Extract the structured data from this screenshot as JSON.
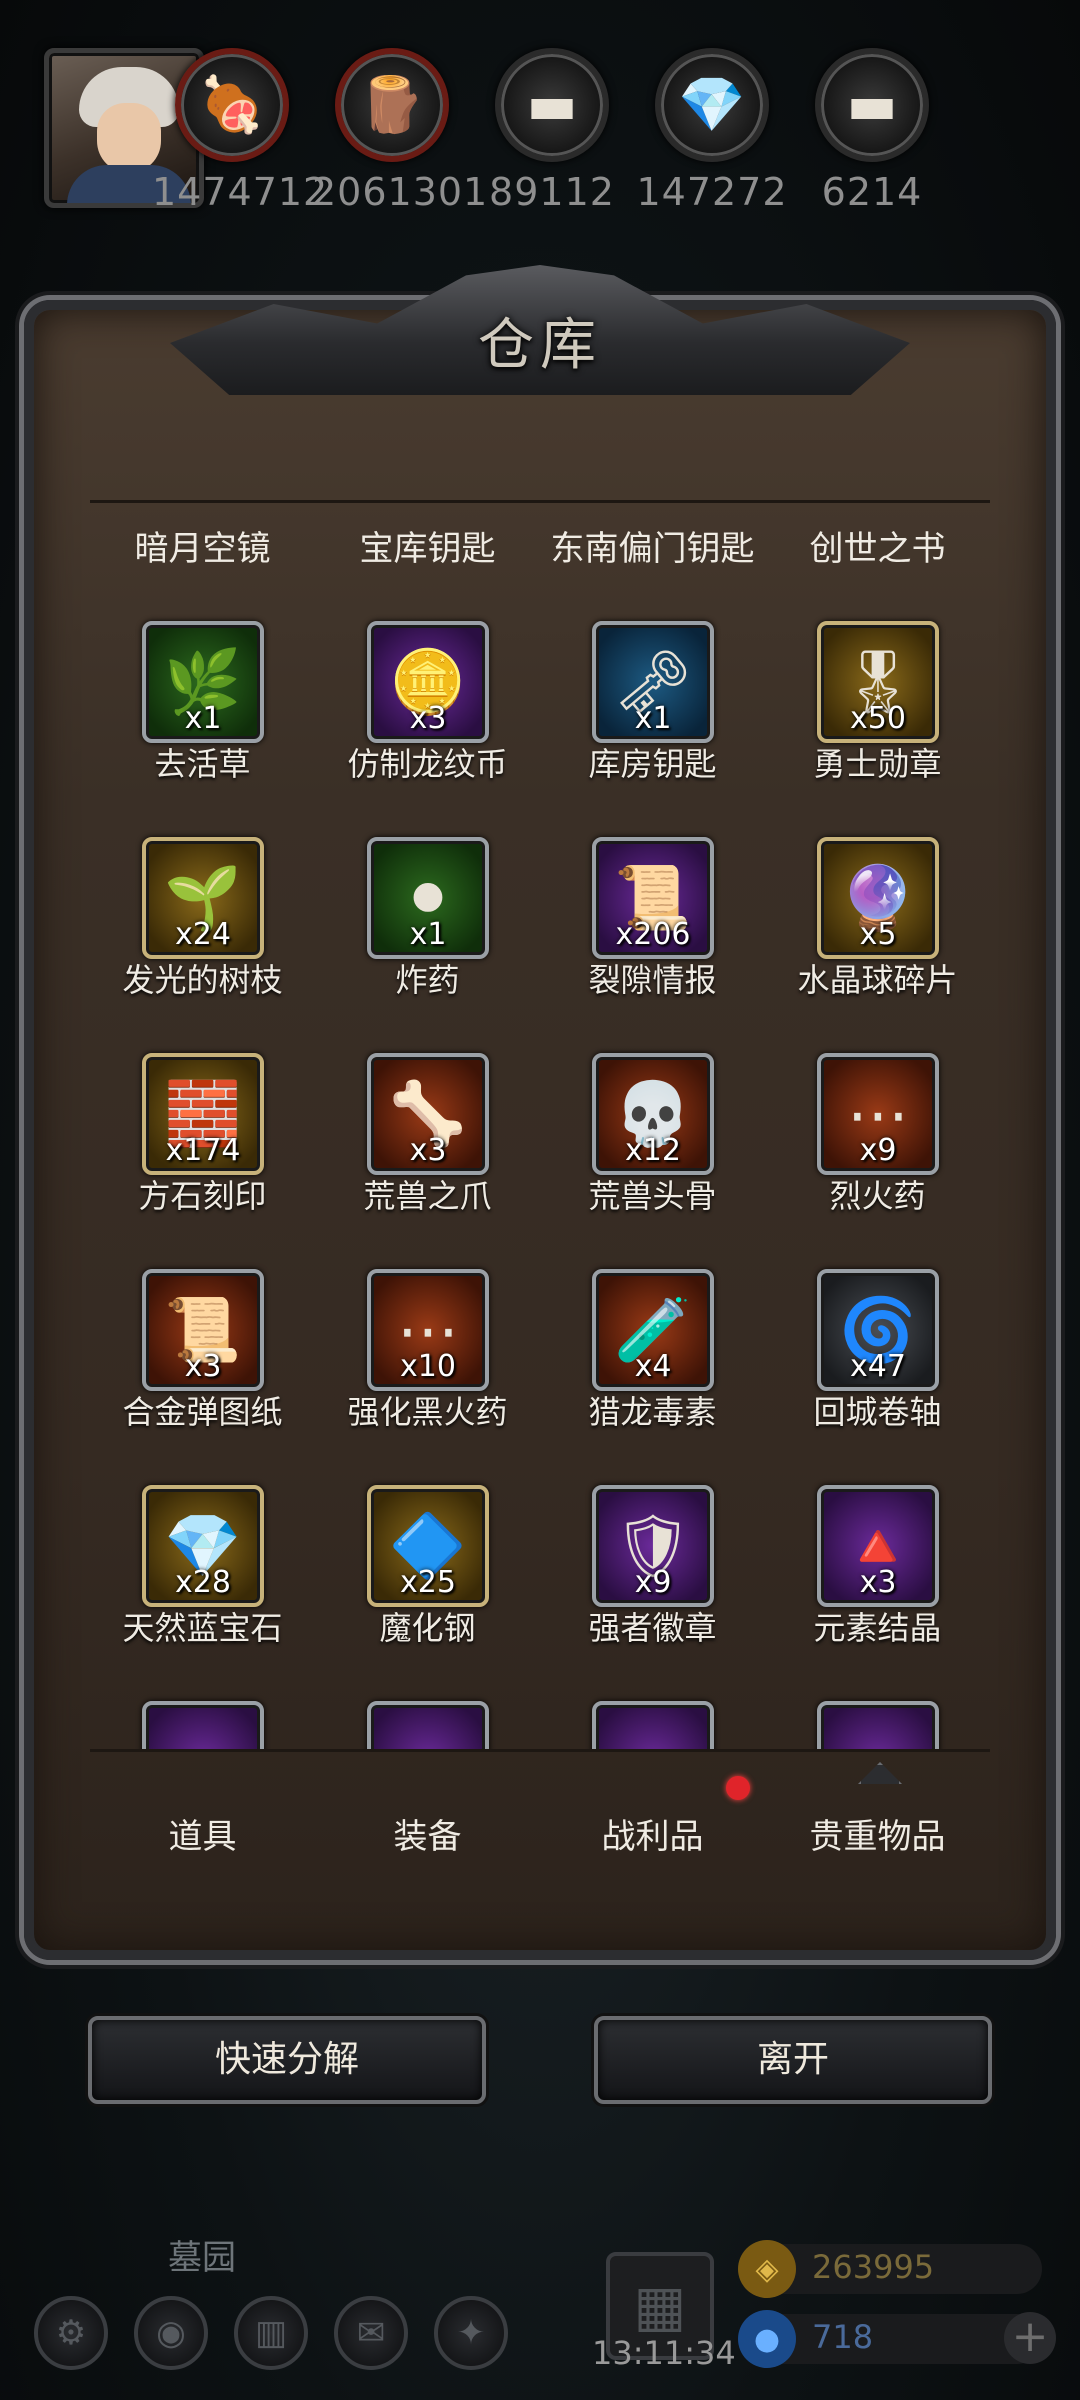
{
  "resources": [
    {
      "icon": "meat-icon",
      "glyph": "🍖",
      "value": "1474712",
      "accent": "red"
    },
    {
      "icon": "wood-icon",
      "glyph": "🪵",
      "value": "2061301",
      "accent": "red"
    },
    {
      "icon": "iron-icon",
      "glyph": "▬",
      "value": "89112",
      "accent": "none"
    },
    {
      "icon": "crystal-icon",
      "glyph": "💎",
      "value": "147272",
      "accent": "none"
    },
    {
      "icon": "steel-icon",
      "glyph": "▬",
      "value": "6214",
      "accent": "none"
    }
  ],
  "panel": {
    "title": "仓库"
  },
  "top_row": [
    "暗月空镜",
    "宝库钥匙",
    "东南偏门钥匙",
    "创世之书"
  ],
  "items": [
    {
      "name": "去活草",
      "count": "x1",
      "rarity": "green",
      "glyph": "🌿"
    },
    {
      "name": "仿制龙纹币",
      "count": "x3",
      "rarity": "purple",
      "glyph": "🪙"
    },
    {
      "name": "库房钥匙",
      "count": "x1",
      "rarity": "blue",
      "glyph": "🗝"
    },
    {
      "name": "勇士勋章",
      "count": "x50",
      "rarity": "gold",
      "glyph": "🎖"
    },
    {
      "name": "发光的树枝",
      "count": "x24",
      "rarity": "gold",
      "glyph": "🌱"
    },
    {
      "name": "炸药",
      "count": "x1",
      "rarity": "green",
      "glyph": "⚫"
    },
    {
      "name": "裂隙情报",
      "count": "x206",
      "rarity": "purple",
      "glyph": "📜"
    },
    {
      "name": "水晶球碎片",
      "count": "x5",
      "rarity": "gold",
      "glyph": "🔮"
    },
    {
      "name": "方石刻印",
      "count": "x174",
      "rarity": "gold",
      "glyph": "🧱"
    },
    {
      "name": "荒兽之爪",
      "count": "x3",
      "rarity": "orange",
      "glyph": "🦴"
    },
    {
      "name": "荒兽头骨",
      "count": "x12",
      "rarity": "orange",
      "glyph": "💀"
    },
    {
      "name": "烈火药",
      "count": "x9",
      "rarity": "orange",
      "glyph": "⋯"
    },
    {
      "name": "合金弹图纸",
      "count": "x3",
      "rarity": "orange",
      "glyph": "📜"
    },
    {
      "name": "强化黑火药",
      "count": "x10",
      "rarity": "orange",
      "glyph": "⋯"
    },
    {
      "name": "猎龙毒素",
      "count": "x4",
      "rarity": "orange",
      "glyph": "🧪"
    },
    {
      "name": "回城卷轴",
      "count": "x47",
      "rarity": "gray",
      "glyph": "🌀"
    },
    {
      "name": "天然蓝宝石",
      "count": "x28",
      "rarity": "gold",
      "glyph": "💎"
    },
    {
      "name": "魔化钢",
      "count": "x25",
      "rarity": "gold",
      "glyph": "🔷"
    },
    {
      "name": "强者徽章",
      "count": "x9",
      "rarity": "purple",
      "glyph": "🛡"
    },
    {
      "name": "元素结晶",
      "count": "x3",
      "rarity": "purple",
      "glyph": "🔺"
    }
  ],
  "tabs": [
    "道具",
    "装备",
    "战利品",
    "贵重物品"
  ],
  "buttons": {
    "decompose": "快速分解",
    "leave": "离开"
  },
  "hud": {
    "location": "墓园",
    "time": "13:11:34",
    "gold": "263995",
    "gems": "718"
  }
}
